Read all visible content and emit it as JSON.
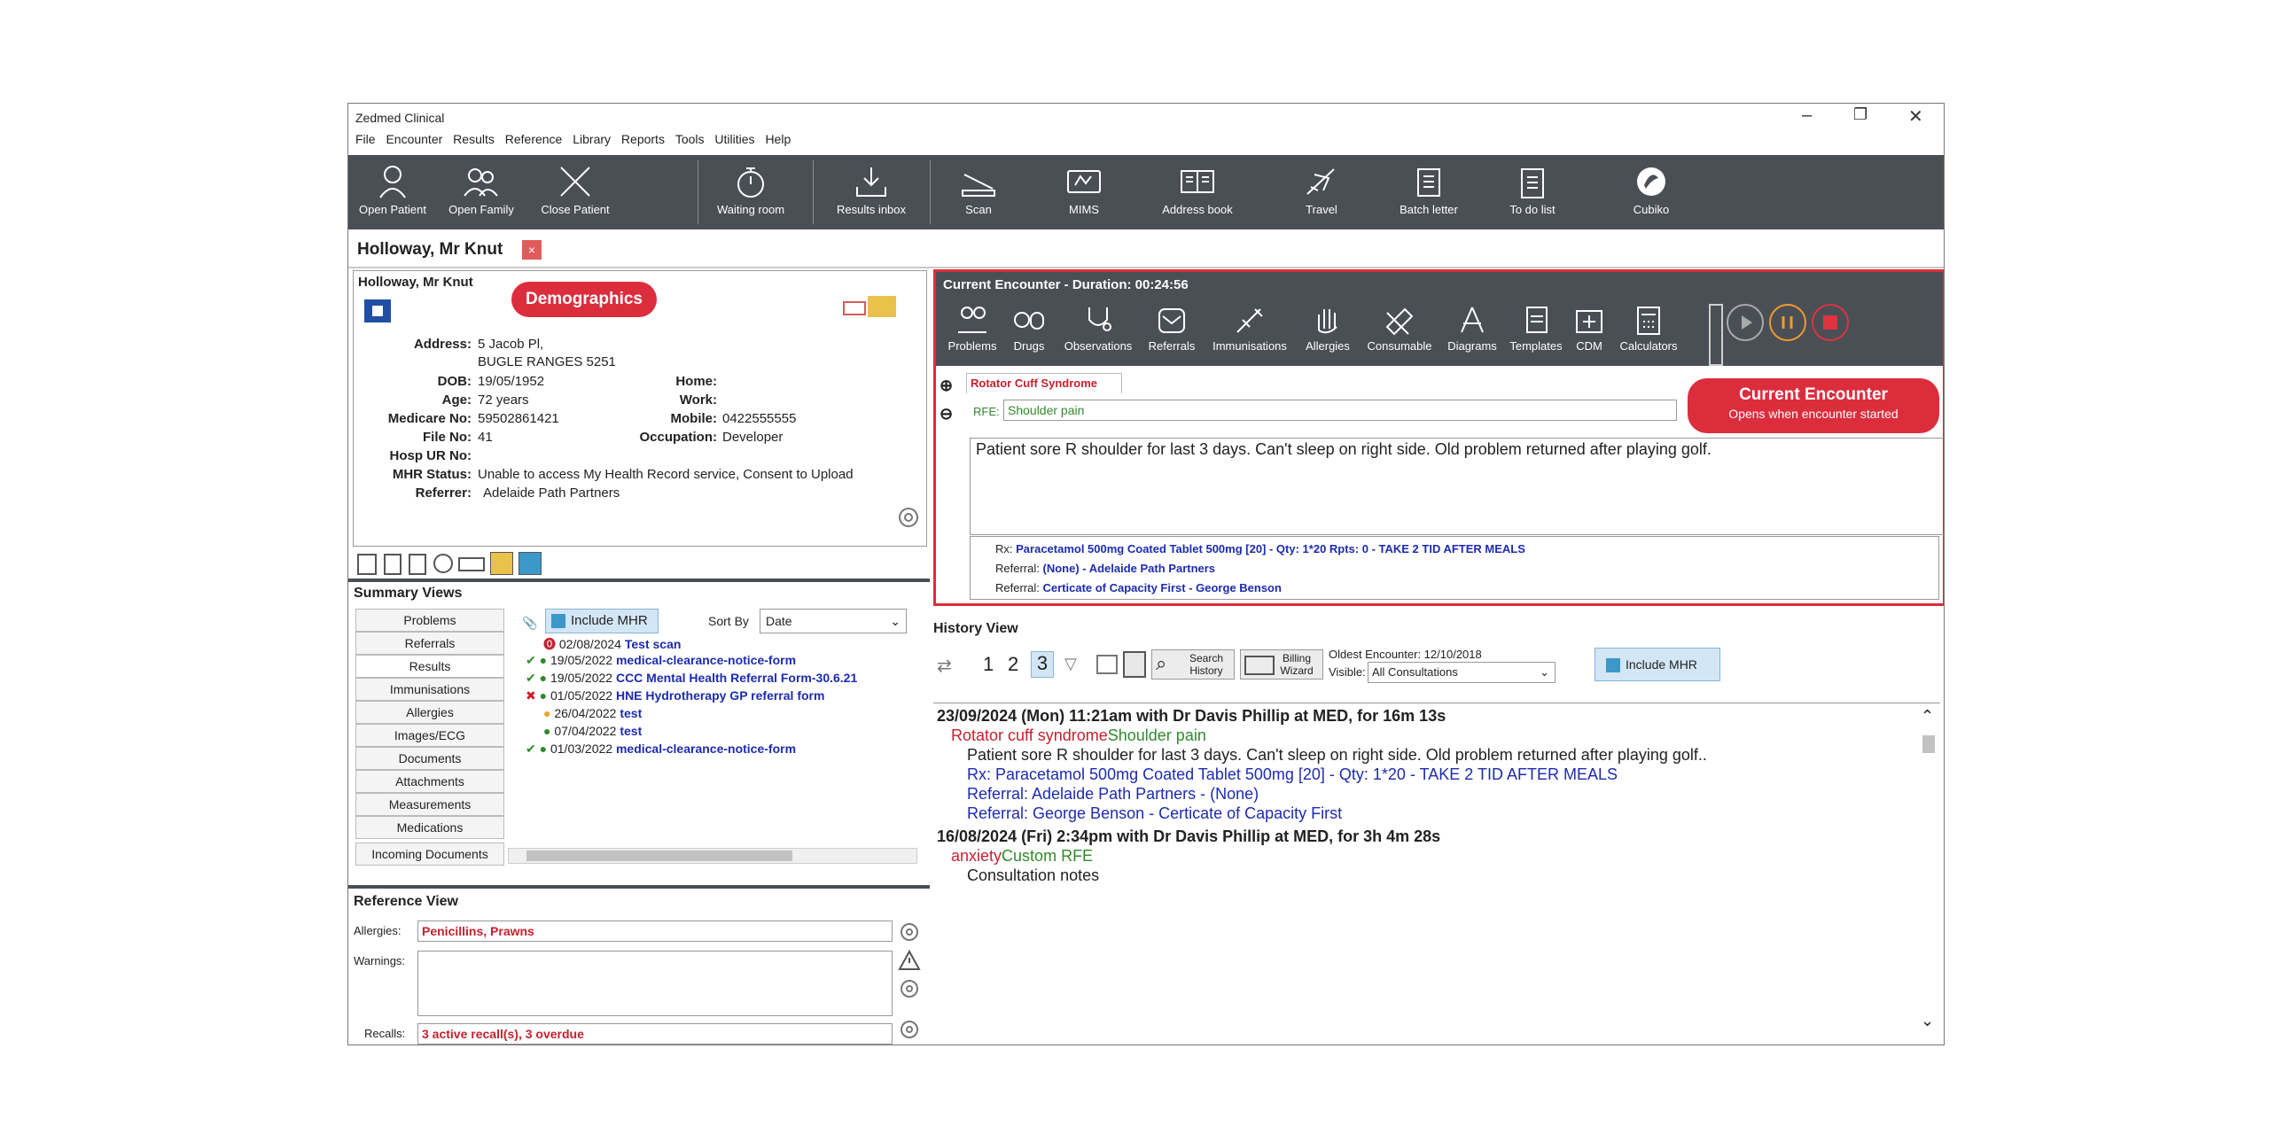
{
  "window": {
    "app_title": "Zedmed Clinical",
    "minimize": "–",
    "restore": "❐",
    "close": "✕"
  },
  "menu": [
    "File",
    "Encounter",
    "Results",
    "Reference",
    "Library",
    "Reports",
    "Tools",
    "Utilities",
    "Help"
  ],
  "toolbar": {
    "open_patient": "Open Patient",
    "open_family": "Open Family",
    "close_patient": "Close Patient",
    "waiting_room": "Waiting room",
    "results_inbox": "Results inbox",
    "scan": "Scan",
    "mims": "MIMS",
    "address_book": "Address book",
    "travel": "Travel",
    "batch_letter": "Batch letter",
    "to_do_list": "To do list",
    "cubiko": "Cubiko"
  },
  "patient_tab": {
    "name": "Holloway, Mr Knut",
    "close": "×"
  },
  "demographics": {
    "name": "Holloway, Mr Knut",
    "callout": "Demographics",
    "address_label": "Address:",
    "address_line1": "5 Jacob Pl,",
    "address_line2": "BUGLE RANGES  5251",
    "dob_label": "DOB:",
    "dob": "19/05/1952",
    "age_label": "Age:",
    "age": "72 years",
    "medicare_label": "Medicare No:",
    "medicare": "59502861421",
    "file_label": "File No:",
    "file": "41",
    "hosp_label": "Hosp UR No:",
    "mhr_label": "MHR Status:",
    "mhr": "Unable to access My Health Record service, Consent to Upload",
    "referrer_label": "Referrer:",
    "referrer": "Adelaide Path Partners",
    "home_label": "Home:",
    "work_label": "Work:",
    "mobile_label": "Mobile:",
    "mobile": "0422555555",
    "occupation_label": "Occupation:",
    "occupation": "Developer"
  },
  "summary": {
    "title": "Summary Views",
    "nav": [
      "Problems",
      "Referrals",
      "Results",
      "Immunisations",
      "Allergies",
      "Images/ECG",
      "Documents",
      "Attachments",
      "Measurements",
      "Medications"
    ],
    "incoming": "Incoming Documents",
    "include_mhr": "Include MHR",
    "sort_by_label": "Sort By",
    "sort_by_value": "Date",
    "results": [
      {
        "date": "02/08/2024",
        "name": "Test scan"
      },
      {
        "date": "19/05/2022",
        "name": "medical-clearance-notice-form"
      },
      {
        "date": "19/05/2022",
        "name": "CCC Mental Health Referral Form-30.6.21"
      },
      {
        "date": "01/05/2022",
        "name": "HNE Hydrotherapy GP referral form"
      },
      {
        "date": "26/04/2022",
        "name": "test"
      },
      {
        "date": "07/04/2022",
        "name": "test"
      },
      {
        "date": "01/03/2022",
        "name": "medical-clearance-notice-form"
      }
    ]
  },
  "reference": {
    "title": "Reference View",
    "allergies_label": "Allergies:",
    "allergies": "Penicillins, Prawns",
    "warnings_label": "Warnings:",
    "recalls_label": "Recalls:",
    "recalls": "3 active recall(s), 3 overdue"
  },
  "encounter": {
    "title": "Current Encounter - Duration: 00:24:56",
    "tools": [
      "Problems",
      "Drugs",
      "Observations",
      "Referrals",
      "Immunisations",
      "Allergies",
      "Consumable",
      "Diagrams",
      "Templates",
      "CDM",
      "Calculators"
    ],
    "problem_tab": "Rotator Cuff Syndrome",
    "rfe_label": "RFE:",
    "rfe_value": "Shoulder pain",
    "notes": "Patient sore R shoulder for last 3 days. Can't sleep on right side. Old problem returned after playing golf.",
    "rx_prefix": "Rx:",
    "rx": "Paracetamol 500mg Coated Tablet 500mg [20] - Qty: 1*20 Rpts: 0 - TAKE 2 TID AFTER MEALS",
    "referral_prefix": "Referral:",
    "referral1": "(None) - Adelaide Path Partners",
    "referral2": "Certicate of Capacity First - George Benson",
    "callout_title": "Current Encounter",
    "callout_sub": "Opens when encounter started"
  },
  "history": {
    "title": "History View",
    "pages": [
      "1",
      "2",
      "3"
    ],
    "search": "Search History",
    "billing": "Billing Wizard",
    "oldest": "Oldest Encounter: 12/10/2018",
    "visible_label": "Visible:",
    "visible_value": "All Consultations",
    "include_mhr": "Include MHR",
    "entry1_header": "23/09/2024 (Mon) 11:21am with Dr Davis Phillip at MED, for 16m 13s",
    "entry1_problem": "Rotator cuff syndrome",
    "entry1_rfe": "Shoulder pain",
    "entry1_note": "Patient sore R shoulder for last 3 days. Can't sleep on right side. Old problem returned after playing golf..",
    "entry1_rx": "Rx: Paracetamol 500mg Coated Tablet 500mg [20] - Qty: 1*20 - TAKE 2 TID AFTER MEALS",
    "entry1_ref1": "Referral: Adelaide Path Partners - (None)",
    "entry1_ref2": "Referral: George Benson - Certicate of Capacity First",
    "entry2_header": "16/08/2024 (Fri) 2:34pm with Dr Davis Phillip at MED, for 3h 4m 28s",
    "entry2_problem": "anxiety",
    "entry2_rfe": "Custom RFE",
    "entry2_note": "Consultation notes"
  },
  "colors": {
    "toolbar_bg": "#4a4f55",
    "accent_red": "#dc2d3d",
    "link_blue": "#1d2bb0",
    "rfe_green": "#2f8a2b"
  }
}
